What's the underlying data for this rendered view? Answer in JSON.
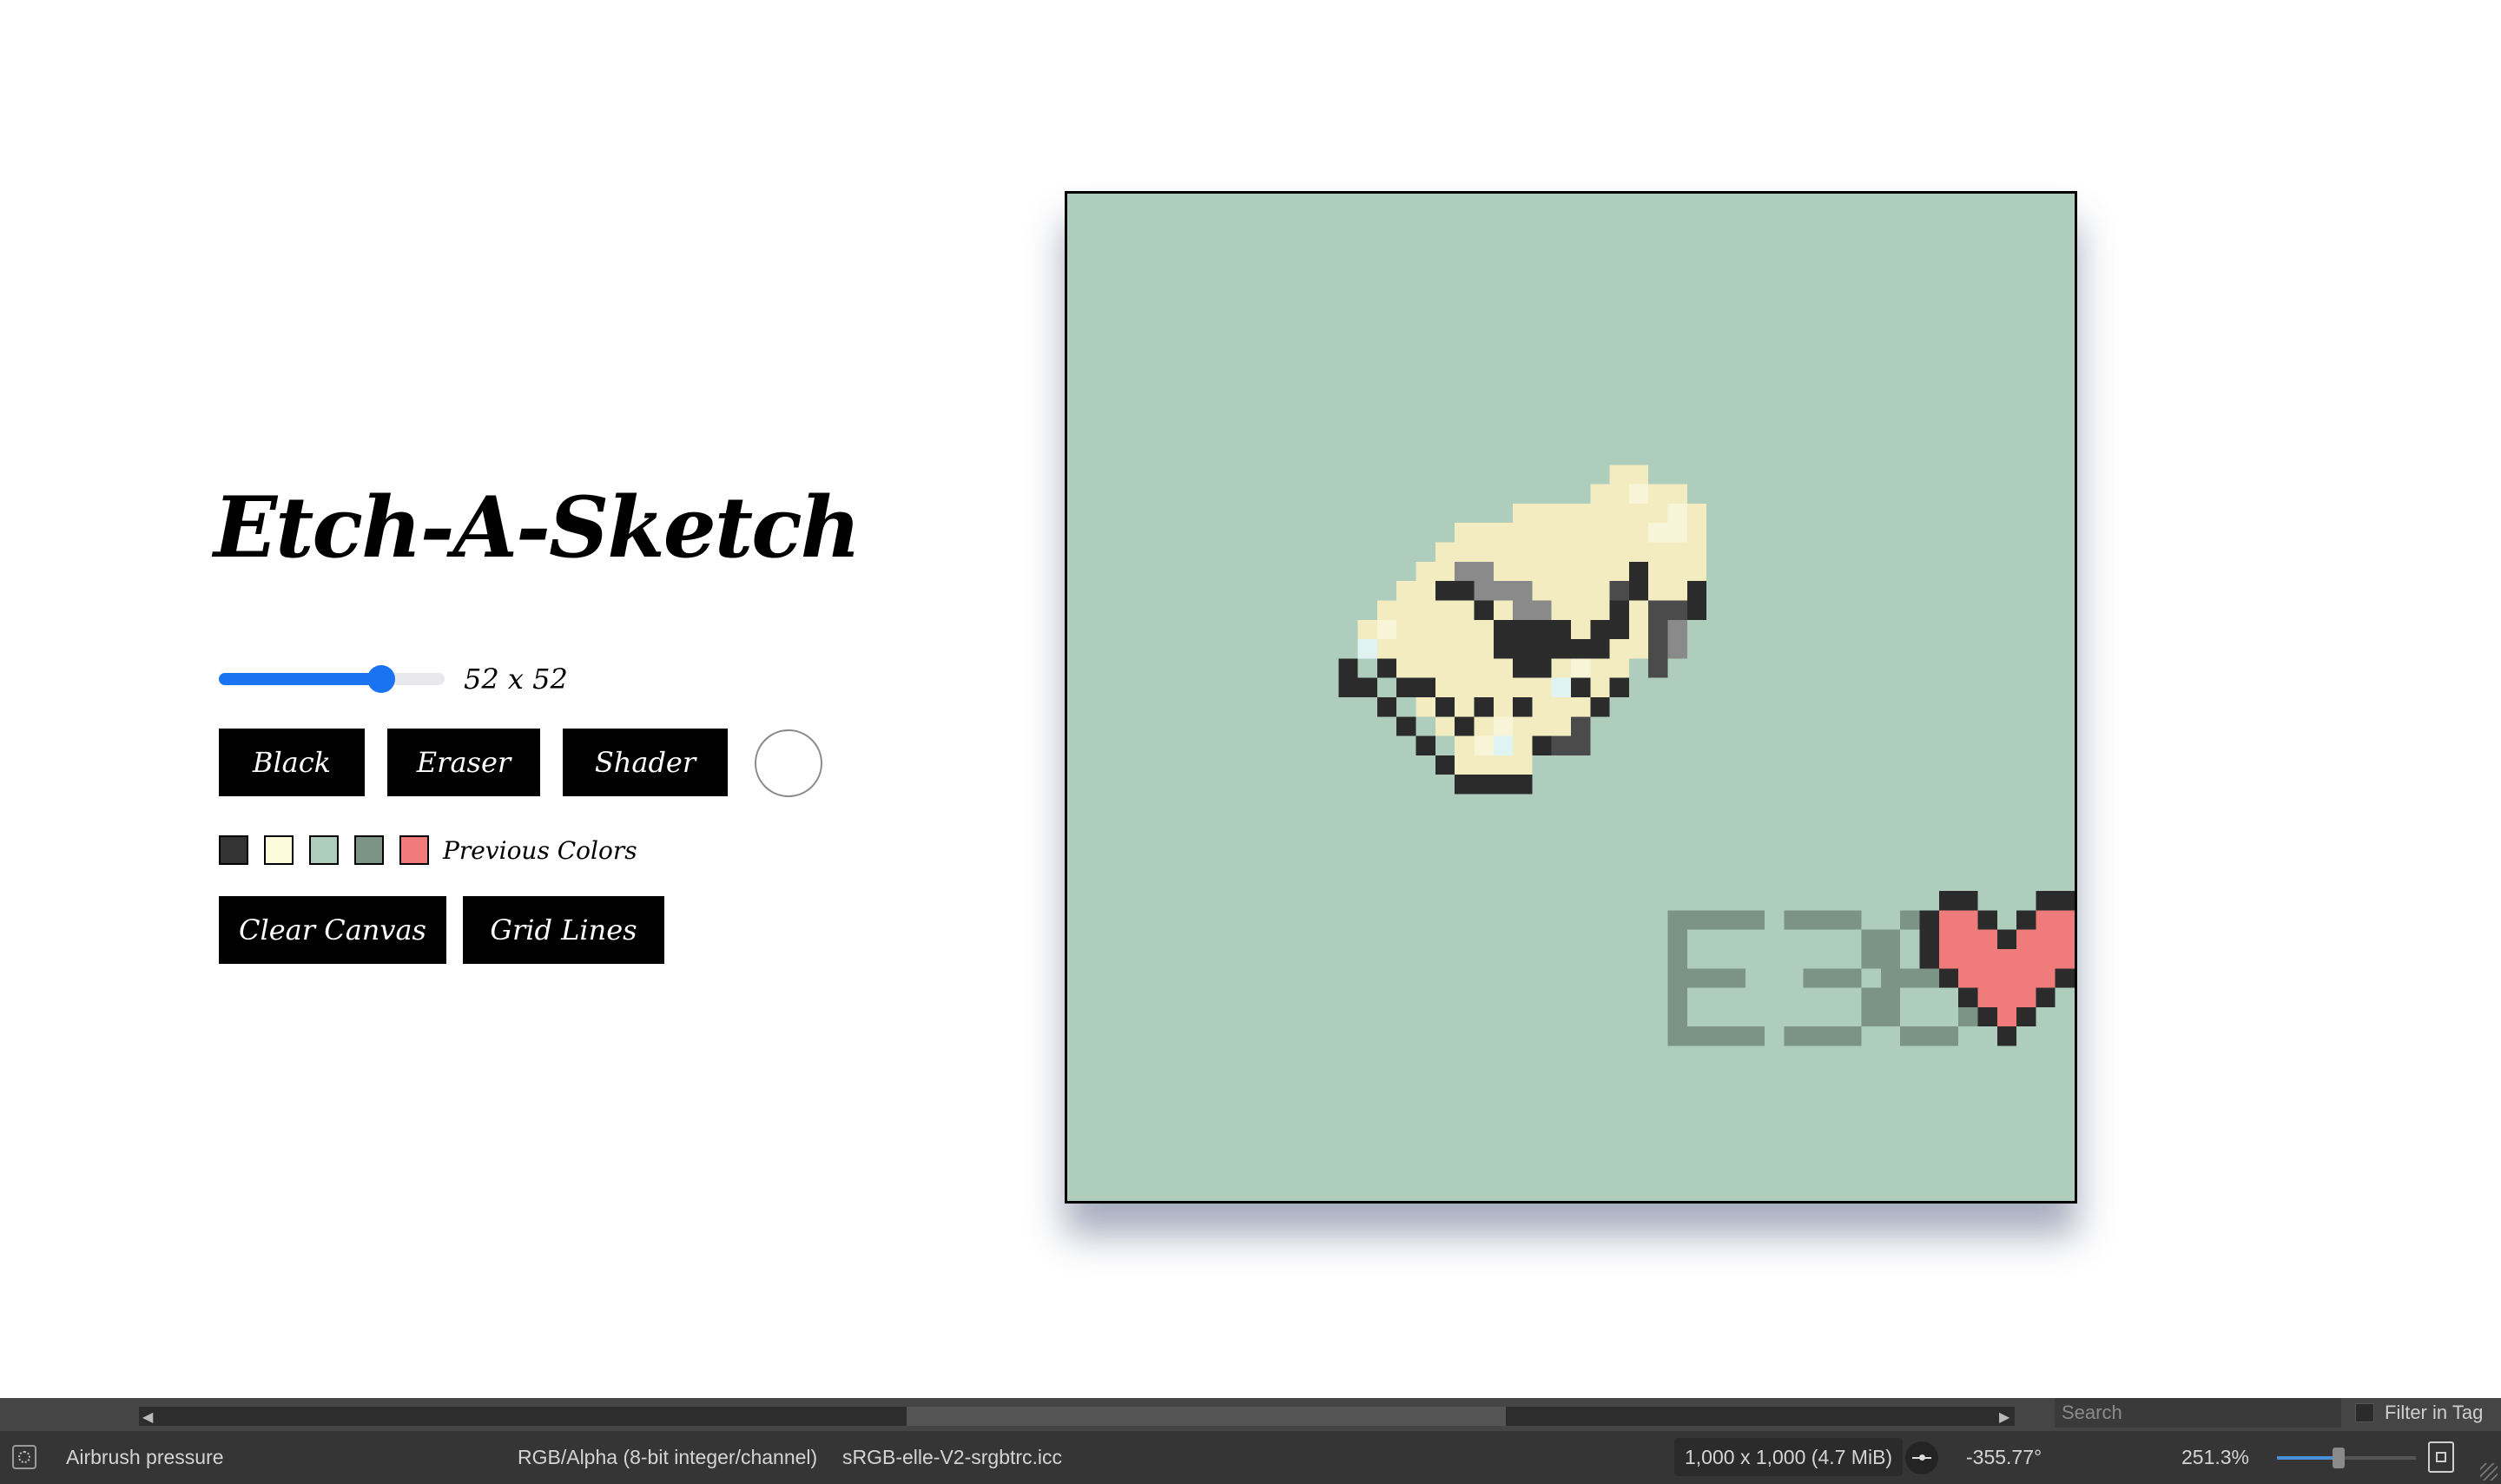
{
  "app": {
    "title": "Etch-A-Sketch"
  },
  "controls": {
    "grid_size_label": "52 x 52",
    "grid_size_value": 52,
    "slider_fraction": 0.72,
    "buttons": {
      "black": "Black",
      "eraser": "Eraser",
      "shader": "Shader",
      "clear_canvas": "Clear Canvas",
      "grid_lines": "Grid Lines"
    },
    "current_color": "#ffffff",
    "previous_colors_label": "Previous Colors",
    "previous_colors": [
      "#333333",
      "#fdfbdc",
      "#afcdbd",
      "#7b9485",
      "#ef7c7b"
    ]
  },
  "canvas": {
    "background": "#afcdbd",
    "text": "E36",
    "text_color": "#7b9485",
    "heart_color": "#ef7c7b",
    "outline_color": "#2b2b2b",
    "skull_color": "#f2ecc0"
  },
  "statusbar": {
    "tool": "Airbrush pressure",
    "color_mode": "RGB/Alpha (8-bit integer/channel)",
    "profile": "sRGB-elle-V2-srgbtrc.icc",
    "dimensions": "1,000 x 1,000 (4.7 MiB)",
    "rotation": "-355.77°",
    "zoom": "251.3%",
    "zoom_fraction": 0.44,
    "search_placeholder": "Search",
    "filter_label": "Filter in Tag"
  }
}
